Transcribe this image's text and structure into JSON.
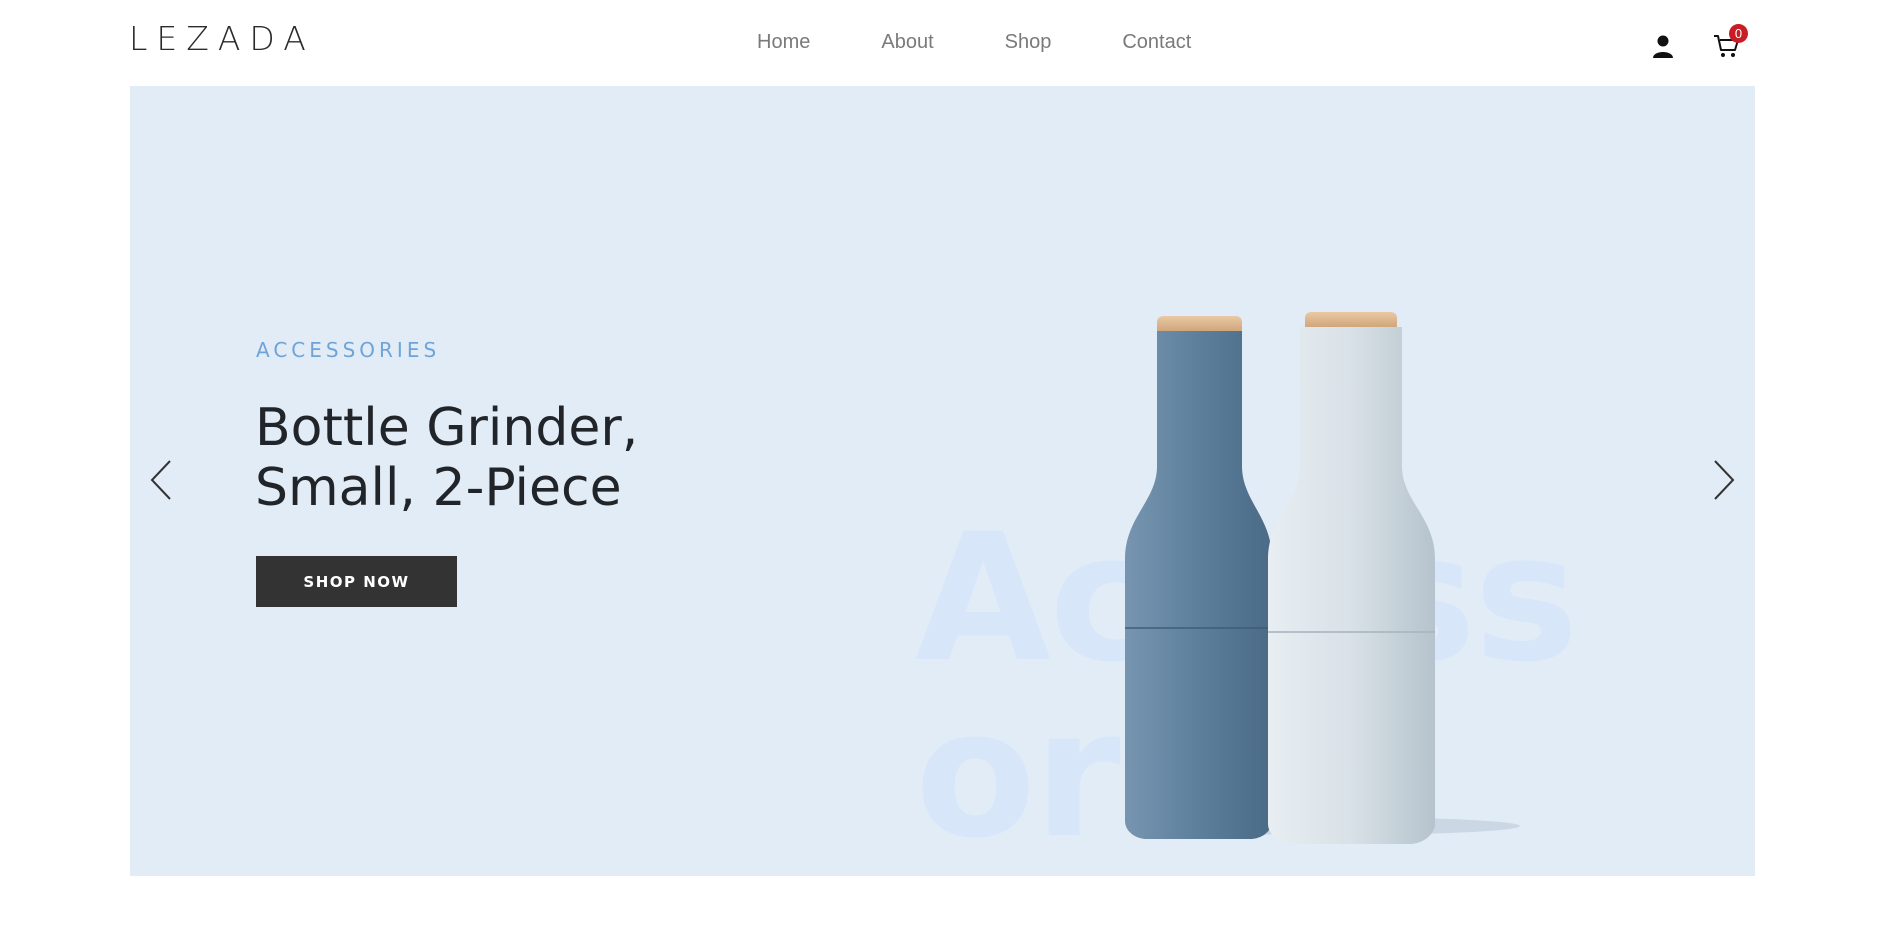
{
  "brand": {
    "logo_text": "LEZADA"
  },
  "nav": {
    "items": [
      {
        "label": "Home"
      },
      {
        "label": "About"
      },
      {
        "label": "Shop"
      },
      {
        "label": "Contact"
      }
    ]
  },
  "header_actions": {
    "user_icon": "user-icon",
    "cart_icon": "cart-icon",
    "cart_count": "0",
    "badge_color": "#c81d25"
  },
  "hero": {
    "eyebrow": "ACCESSORIES",
    "title": "Bottle Grinder, Small, 2-Piece",
    "cta_label": "SHOP NOW",
    "watermark": "Accessories",
    "background_color": "#e2ecf7",
    "accent_color": "#6fa4d8",
    "prev_icon": "chevron-left-icon",
    "next_icon": "chevron-right-icon"
  }
}
